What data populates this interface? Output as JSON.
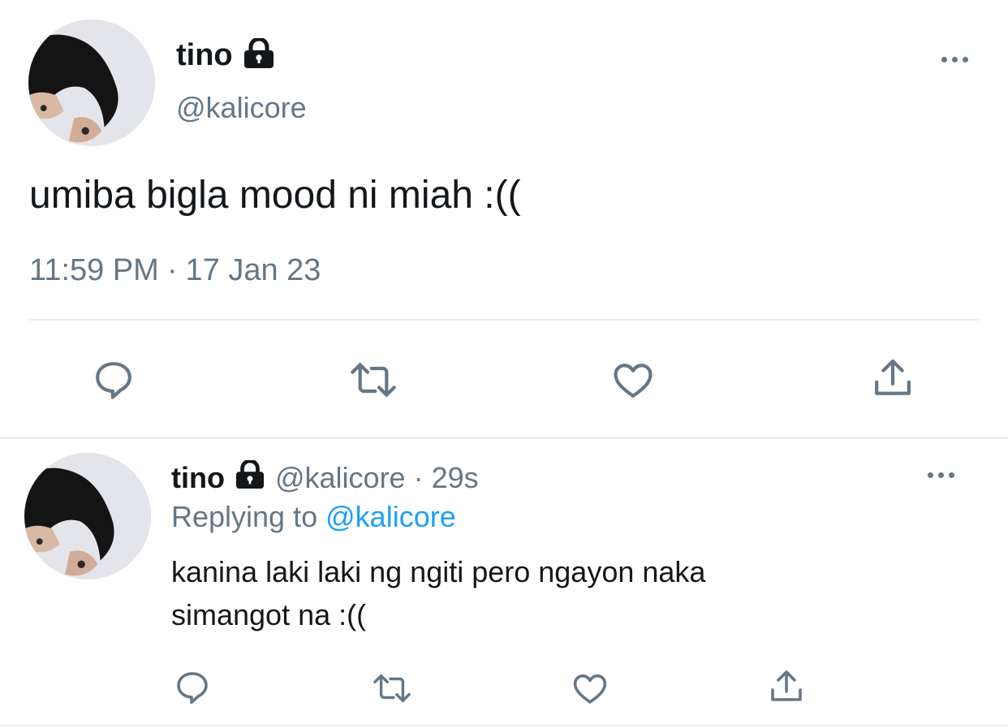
{
  "main_tweet": {
    "display_name": "tino",
    "handle": "@kalicore",
    "text": "umiba bigla mood ni miah :((",
    "time": "11:59 PM",
    "separator": "·",
    "date": "17 Jan 23",
    "protected": true,
    "icons": [
      "lock-icon",
      "more-icon",
      "reply-icon",
      "retweet-icon",
      "like-icon",
      "share-icon"
    ]
  },
  "reply_tweet": {
    "display_name": "tino",
    "handle": "@kalicore",
    "separator": "·",
    "age": "29s",
    "replying_prefix": "Replying to",
    "replying_handle": "@kalicore",
    "text_line1": "kanina laki laki ng ngiti pero ngayon naka",
    "text_line2": "simangot na :((",
    "protected": true
  },
  "colors": {
    "text": "#14171a",
    "muted": "#657786",
    "accent": "#1da1f2",
    "divider": "#e6ecf0",
    "background": "#ffffff"
  }
}
